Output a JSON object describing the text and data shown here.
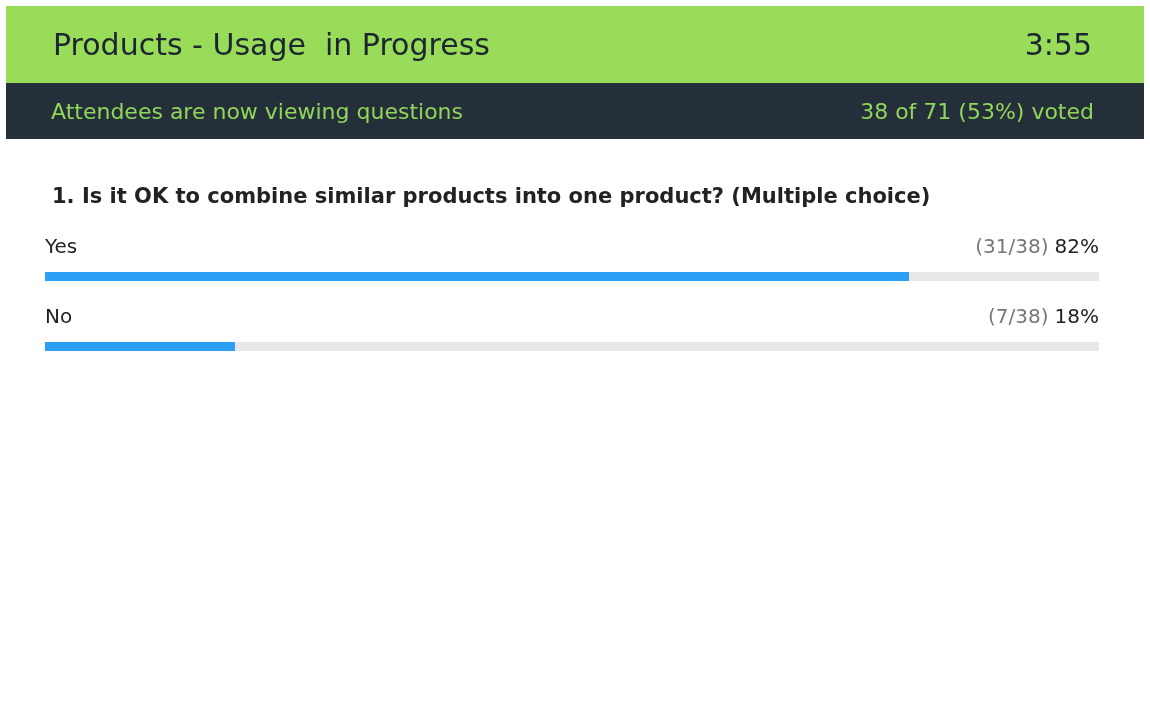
{
  "header": {
    "title": "Products - Usage  in Progress",
    "timer": "3:55"
  },
  "status_bar": {
    "message": "Attendees are now viewing questions",
    "votes": "38 of 71 (53%) voted"
  },
  "question": {
    "text": "1. Is it OK to combine similar products into one product? (Multiple choice)",
    "options": [
      {
        "label": "Yes",
        "count": "(31/38)",
        "percent": "82%",
        "level": 0.82
      },
      {
        "label": "No",
        "count": "(7/38)",
        "percent": "18%",
        "level": 0.18
      }
    ]
  }
}
